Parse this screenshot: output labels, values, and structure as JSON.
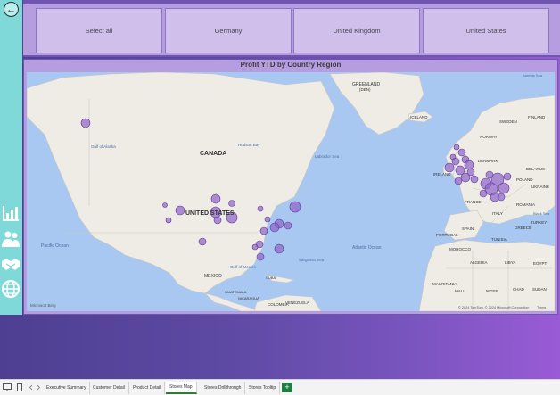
{
  "slicer": {
    "buttons": [
      {
        "label": "Select all"
      },
      {
        "label": "Germany"
      },
      {
        "label": "United Kingdom"
      },
      {
        "label": "United States"
      }
    ]
  },
  "map": {
    "title": "Profit YTD by Country Region",
    "labels": {
      "canada": "CANADA",
      "united_states": "UNITED STATES",
      "mexico": "MEXICO",
      "greenland": "GREENLAND",
      "greenland_den": "(DEN)",
      "iceland": "ICELAND",
      "sweden": "SWEDEN",
      "norway": "NORWAY",
      "finland": "FINLAND",
      "denmark": "DENMARK",
      "ireland": "IRELAND",
      "france": "FRANCE",
      "spain": "SPAIN",
      "portugal": "PORTUGAL",
      "belarus": "BELARUS",
      "ukraine": "UKRAINE",
      "romania": "ROMANIA",
      "poland": "POLAND",
      "italy": "ITALY",
      "greece": "GREECE",
      "turkey": "TURKEY",
      "morocco": "MOROCCO",
      "algeria": "ALGERIA",
      "libya": "LIBYA",
      "egypt": "EGYPT",
      "tunisia": "TUNISIA",
      "mauritania": "MAURITANIA",
      "mali": "MALI",
      "niger": "NIGER",
      "chad": "CHAD",
      "sudan": "SUDAN",
      "pacific_ocean": "Pacific Ocean",
      "atlantic_ocean": "Atlantic Ocean",
      "hudson_bay": "Hudson Bay",
      "labrador_sea": "Labrador Sea",
      "gulf_alaska": "Gulf of Alaska",
      "gulf_mexico": "Gulf of Mexico",
      "sargasso": "Sargasso Sea",
      "black_sea": "Black Sea",
      "barents_sea": "Barents Sea",
      "guatemala": "GUATEMALA",
      "cuba": "CUBA",
      "venezuela": "VENEZUELA",
      "colombia": "COLOMBIA",
      "nicaragua": "NICARAGUA"
    },
    "attribution": "Microsoft Bing",
    "copyright": "© 2024 TomTom, © 2024 Microsoft Corporation",
    "terms": "Terms",
    "bubble_color": "#8e62c9"
  },
  "tabs": {
    "items": [
      {
        "label": "Executive Summary"
      },
      {
        "label": "Customer Detail"
      },
      {
        "label": "Product Detail"
      },
      {
        "label": "Stores Map"
      },
      {
        "label": "Stores Drillthrough"
      },
      {
        "label": "Stores Tooltip"
      }
    ],
    "active_index": 3,
    "add_label": "+"
  },
  "icons": {
    "back": "back-arrow-icon",
    "bar_chart": "bar-chart-icon",
    "people": "people-icon",
    "handshake": "handshake-icon",
    "globe": "globe-icon"
  },
  "colors": {
    "rail": "#7fd9d8",
    "slicer_panel": "#b69ddf",
    "slicer_button": "#cfbfea",
    "accent_dark": "#6f55b0",
    "water": "#a9c8f1",
    "land": "#eeece5",
    "active_tab_underline": "#2e7d32"
  }
}
